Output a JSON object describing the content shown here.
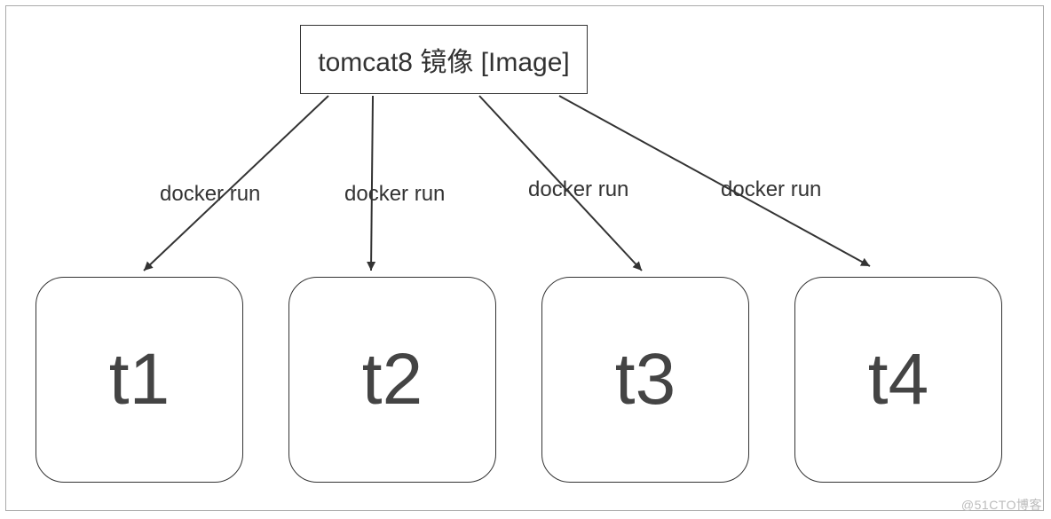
{
  "diagram": {
    "image_box": {
      "label": "tomcat8 镜像 [Image]"
    },
    "edges": [
      {
        "label": "docker run"
      },
      {
        "label": "docker run"
      },
      {
        "label": "docker run"
      },
      {
        "label": "docker run"
      }
    ],
    "containers": [
      {
        "label": "t1"
      },
      {
        "label": "t2"
      },
      {
        "label": "t3"
      },
      {
        "label": "t4"
      }
    ]
  },
  "watermark": "@51CTO博客"
}
